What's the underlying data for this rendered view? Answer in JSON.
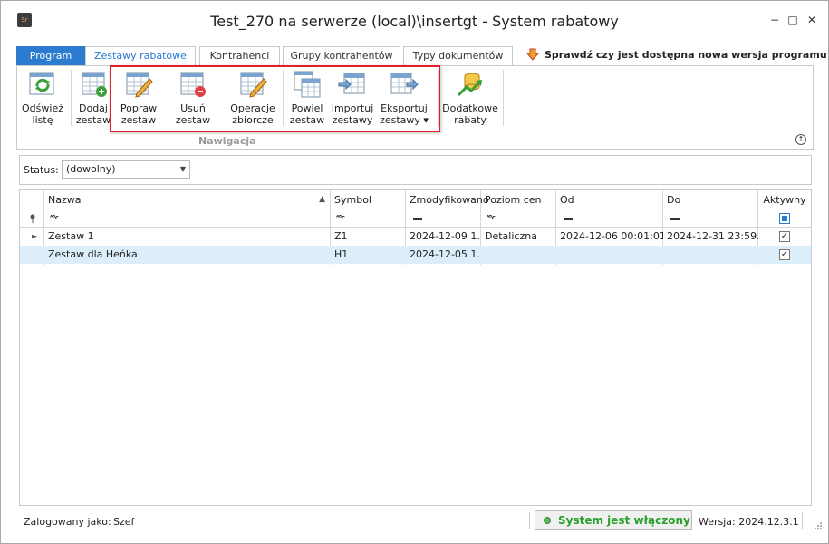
{
  "window": {
    "title": "Test_270 na serwerze (local)\\insertgt - System rabatowy",
    "app_icon_text": "Sr",
    "minimize": "−",
    "maximize": "□",
    "close": "✕"
  },
  "tabs": [
    {
      "label": "Program"
    },
    {
      "label": "Zestawy rabatowe"
    },
    {
      "label": "Kontrahenci"
    },
    {
      "label": "Grupy kontrahentów"
    },
    {
      "label": "Typy dokumentów"
    }
  ],
  "update_link": "Sprawdź czy jest dostępna nowa wersja programu",
  "ribbon": {
    "refresh": [
      "Odśwież",
      "listę"
    ],
    "add": [
      "Dodaj",
      "zestaw"
    ],
    "edit": [
      "Popraw",
      "zestaw"
    ],
    "delete": [
      "Usuń zestaw"
    ],
    "bulk": [
      "Operacje",
      "zbiorcze"
    ],
    "duplicate": [
      "Powiel",
      "zestaw"
    ],
    "import": [
      "Importuj",
      "zestawy"
    ],
    "export": [
      "Eksportuj",
      "zestawy ▾"
    ],
    "extra": [
      "Dodatkowe",
      "rabaty"
    ],
    "group_label": "Nawigacja"
  },
  "filter": {
    "label": "Status:",
    "value": "(dowolny)"
  },
  "grid": {
    "columns": [
      "Nazwa",
      "Symbol",
      "Zmodyfikowano",
      "Poziom cen",
      "Od",
      "Do",
      "Aktywny"
    ],
    "rows": [
      {
        "name": "Zestaw 1",
        "symbol": "Z1",
        "modified": "2024-12-09 1...",
        "price_level": "Detaliczna",
        "from": "2024-12-06 00:01:01",
        "to": "2024-12-31 23:59...",
        "active": "✓"
      },
      {
        "name": "Zestaw dla Heńka",
        "symbol": "H1",
        "modified": "2024-12-05 1...",
        "price_level": "",
        "from": "",
        "to": "",
        "active": "✓"
      }
    ]
  },
  "status": {
    "logged_label": "Zalogowany jako:",
    "user": "Szef",
    "system_status": "System jest włączony",
    "version": "Wersja: 2024.12.3.1"
  },
  "colors": {
    "accent": "#2b7bd0",
    "highlight": "#e2202c",
    "selected_row": "#ddeefb",
    "status_green": "#2aa02a"
  }
}
